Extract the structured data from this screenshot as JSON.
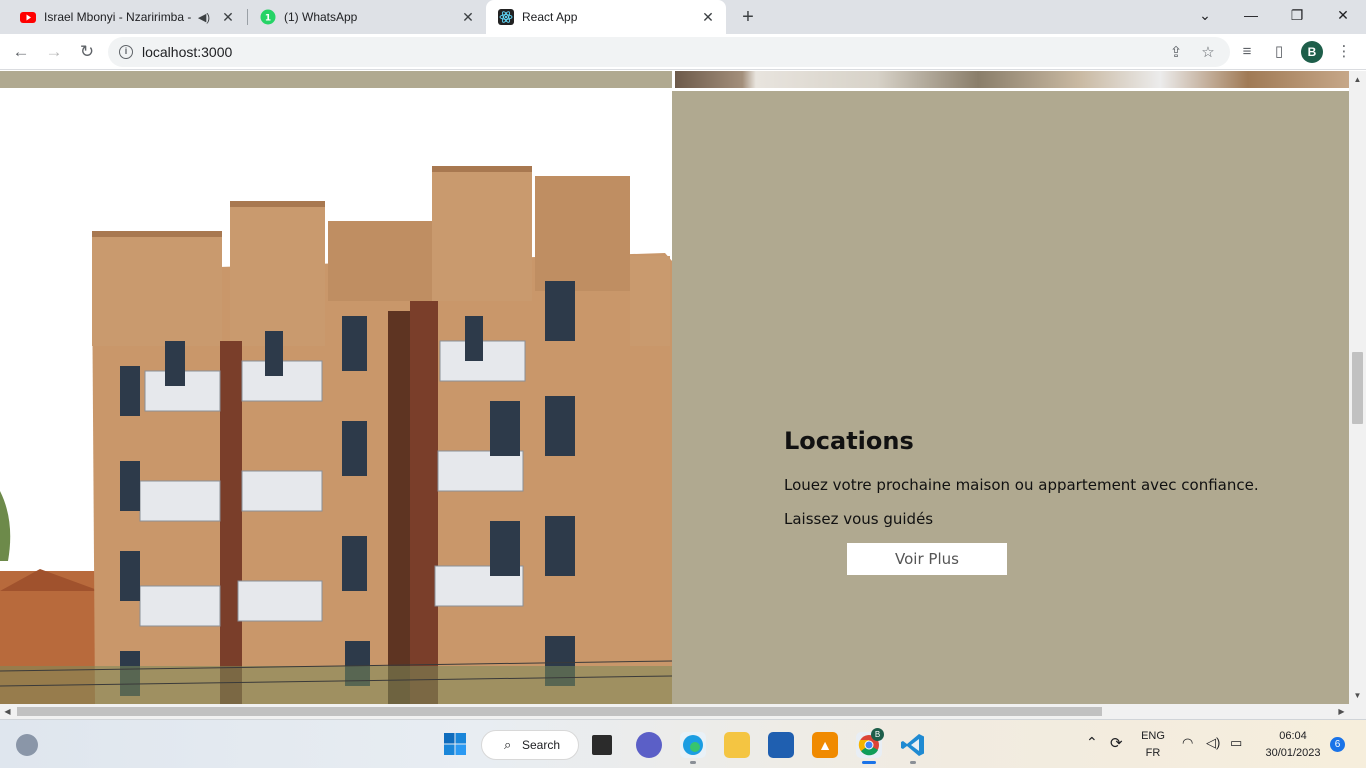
{
  "browser": {
    "tabs": [
      {
        "title": "Israel Mbonyi - Nzaririmba -",
        "favicon": "youtube-icon",
        "audio": true
      },
      {
        "title": "(1) WhatsApp",
        "favicon": "whatsapp-icon"
      },
      {
        "title": "React App",
        "favicon": "react-icon",
        "active": true
      }
    ],
    "url": "localhost:3000",
    "profile_initial": "B"
  },
  "page": {
    "section_title": "Locations",
    "text_line_1": "Louez votre prochaine maison ou appartement avec confiance.",
    "text_line_2": "Laissez vous guidés",
    "button_label": "Voir Plus",
    "panel_color": "#b0a990"
  },
  "taskbar": {
    "search_label": "Search",
    "language_top": "ENG",
    "language_bottom": "FR",
    "time": "06:04",
    "date": "30/01/2023",
    "notification_count": "6",
    "chrome_badge": "B"
  }
}
